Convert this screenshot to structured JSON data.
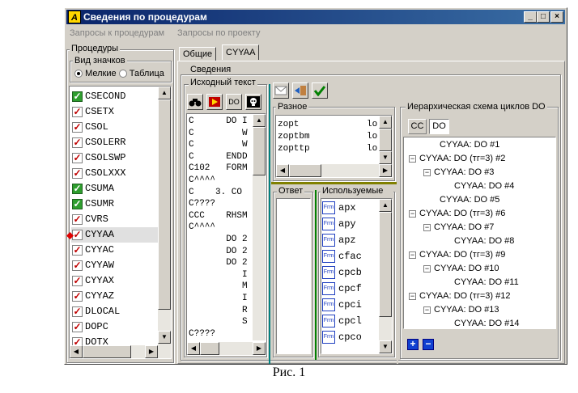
{
  "window": {
    "title": "Сведения по процедурам",
    "buttons": {
      "minimize": "_",
      "maximize": "□",
      "close": "×"
    }
  },
  "menu": [
    "Запросы к процедурам",
    "Запросы по проекту"
  ],
  "left": {
    "group_title": "Процедуры",
    "view_group_title": "Вид значков",
    "radio_small": "Мелкие",
    "radio_table": "Таблица",
    "procedures": [
      {
        "name": "CSECOND",
        "checked": "green"
      },
      {
        "name": "CSETX",
        "checked": "red"
      },
      {
        "name": "CSOL",
        "checked": "red"
      },
      {
        "name": "CSOLERR",
        "checked": "red"
      },
      {
        "name": "CSOLSWP",
        "checked": "red"
      },
      {
        "name": "CSOLXXX",
        "checked": "red"
      },
      {
        "name": "CSUMA",
        "checked": "green"
      },
      {
        "name": "CSUMR",
        "checked": "green"
      },
      {
        "name": "CVRS",
        "checked": "red"
      },
      {
        "name": "CYYAA",
        "checked": "red"
      },
      {
        "name": "CYYAC",
        "checked": "red"
      },
      {
        "name": "CYYAW",
        "checked": "red"
      },
      {
        "name": "CYYAX",
        "checked": "red"
      },
      {
        "name": "CYYAZ",
        "checked": "red"
      },
      {
        "name": "DLOCAL",
        "checked": "red"
      },
      {
        "name": "DOPC",
        "checked": "red"
      },
      {
        "name": "DOTX",
        "checked": "red"
      }
    ]
  },
  "tabs": [
    "Общие",
    "CYYAA"
  ],
  "info": {
    "group_title": "Сведения",
    "source_title": "Исходный текст",
    "source_tools": [
      "DO"
    ],
    "source_lines": [
      "C      DO I",
      "C         W",
      "C         W",
      "C      ENDD",
      "C102   FORM",
      "C^^^^",
      "C    3. CO",
      "C????",
      "CCC    RHSM",
      "C^^^^",
      "       DO 2",
      "       DO 2",
      "       DO 2",
      "          I",
      "          M",
      "          I",
      "          R",
      "          S",
      "C????"
    ],
    "misc_title": "Разное",
    "misc_lines": [
      {
        "name": "zopt",
        "suffix": "lo"
      },
      {
        "name": "zoptbm",
        "suffix": "lo"
      },
      {
        "name": "zopttp",
        "suffix": "lo"
      }
    ],
    "answer_title": "Ответ",
    "used_title": "Используемые",
    "frm_label": "Frm",
    "used_items": [
      "apx",
      "apy",
      "apz",
      "cfac",
      "cpcb",
      "cpcf",
      "cpci",
      "cpcl",
      "cpco"
    ],
    "tree_title": "Иерархическая схема циклов DO",
    "tree_tabs": [
      "CC",
      "DO"
    ],
    "tree": [
      {
        "text": "CYYAA: DO #1",
        "level": 1,
        "node": false
      },
      {
        "text": "CYYAA: DO (тг=3) #2",
        "level": 0,
        "node": true
      },
      {
        "text": "CYYAA: DO #3",
        "level": 1,
        "node": true
      },
      {
        "text": "CYYAA: DO #4",
        "level": 2,
        "node": false
      },
      {
        "text": "CYYAA: DO #5",
        "level": 1,
        "node": false
      },
      {
        "text": "CYYAA: DO (тг=3) #6",
        "level": 0,
        "node": true
      },
      {
        "text": "CYYAA: DO #7",
        "level": 1,
        "node": true
      },
      {
        "text": "CYYAA: DO #8",
        "level": 2,
        "node": false
      },
      {
        "text": "CYYAA: DO (тг=3) #9",
        "level": 0,
        "node": true
      },
      {
        "text": "CYYAA: DO #10",
        "level": 1,
        "node": true
      },
      {
        "text": "CYYAA: DO #11",
        "level": 2,
        "node": false
      },
      {
        "text": "CYYAA: DO (тг=3) #12",
        "level": 0,
        "node": true
      },
      {
        "text": "CYYAA: DO #13",
        "level": 1,
        "node": true
      },
      {
        "text": "CYYAA: DO #14",
        "level": 2,
        "node": false
      }
    ],
    "expand_label": "+",
    "collapse_label": "−"
  },
  "caption": "Рис. 1"
}
